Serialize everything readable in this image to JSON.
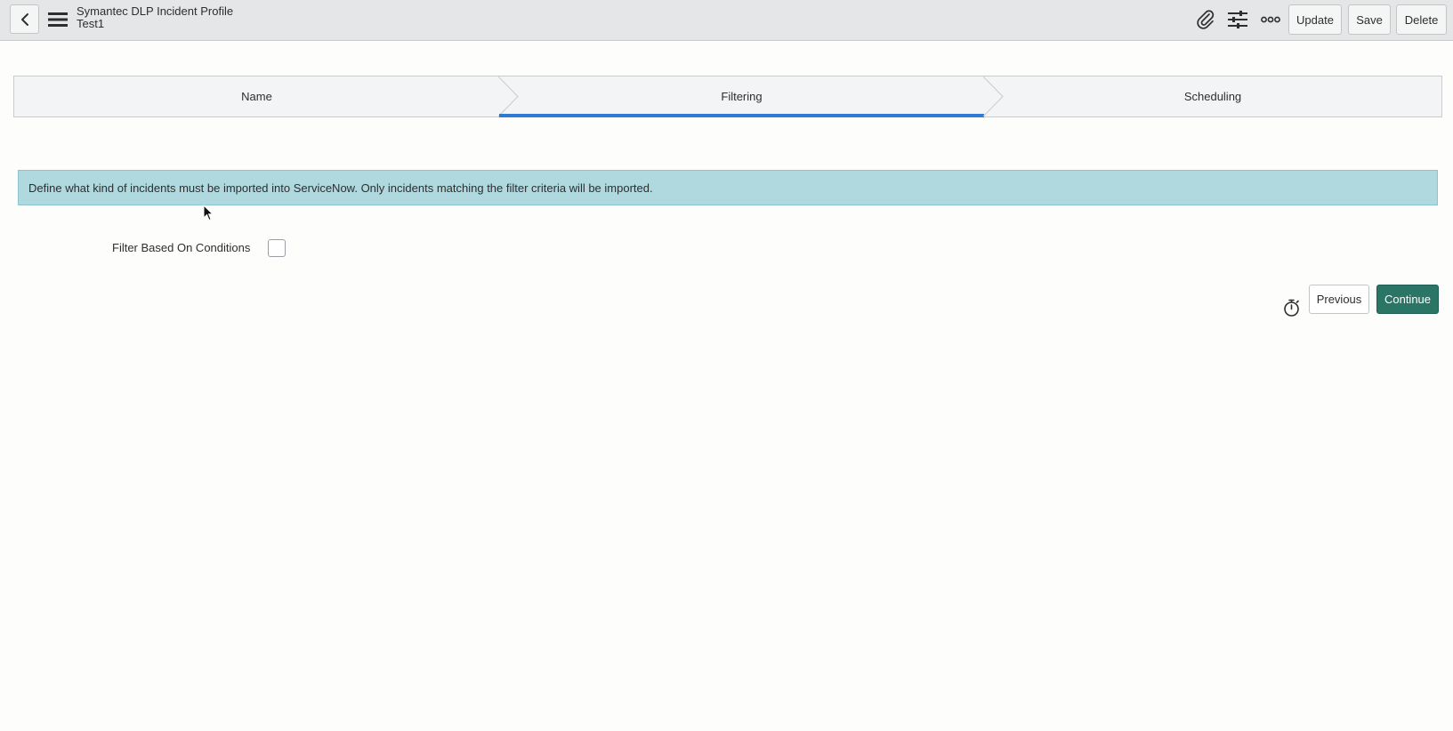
{
  "header": {
    "title": "Symantec DLP Incident Profile",
    "subtitle": "Test1",
    "icons": {
      "back": "chevron-left-icon",
      "menu": "hamburger-menu-icon",
      "attachment": "paperclip-icon",
      "personalize": "sliders-icon",
      "more": "more-options-icon"
    },
    "buttons": {
      "update": "Update",
      "save": "Save",
      "delete": "Delete"
    }
  },
  "stepper": {
    "steps": [
      {
        "label": "Name",
        "active": false
      },
      {
        "label": "Filtering",
        "active": true
      },
      {
        "label": "Scheduling",
        "active": false
      }
    ],
    "active_color": "#2f7ad3"
  },
  "banner": {
    "text": "Define what kind of incidents must be imported into ServiceNow. Only incidents matching the filter criteria will be imported.",
    "background": "#afd8df"
  },
  "form": {
    "filter_label": "Filter Based On Conditions",
    "filter_checked": false
  },
  "footer": {
    "previous_label": "Previous",
    "continue_label": "Continue",
    "continue_color": "#2b7567",
    "timer_icon": "stopwatch-icon"
  }
}
